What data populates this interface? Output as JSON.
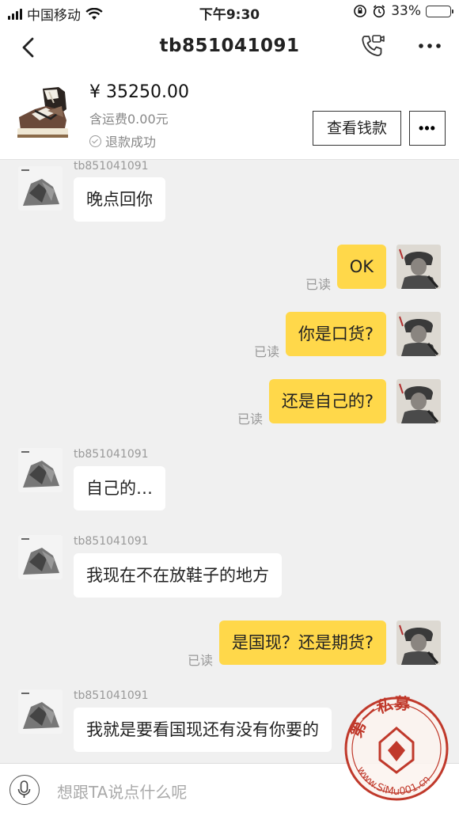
{
  "status_bar": {
    "carrier": "中国移动",
    "time": "下午9:30",
    "battery_percent": "33%",
    "battery_level": 0.33
  },
  "nav": {
    "title": "tb851041091",
    "icons": [
      "chevron-left-icon",
      "video-call-icon",
      "more-dots-icon"
    ]
  },
  "order": {
    "price": "¥ 35250.00",
    "shipping": "含运费0.00元",
    "status": "退款成功",
    "view_money_label": "查看钱款",
    "more_label": "•••"
  },
  "messages": [
    {
      "side": "in",
      "name": "tb851041091",
      "text": "晚点回你"
    },
    {
      "side": "out",
      "read": "已读",
      "text": "OK"
    },
    {
      "side": "out",
      "read": "已读",
      "text": "你是口货?"
    },
    {
      "side": "out",
      "read": "已读",
      "text": "还是自己的?"
    },
    {
      "side": "in",
      "name": "tb851041091",
      "text": "自己的…"
    },
    {
      "side": "in",
      "name": "tb851041091",
      "text": "我现在不在放鞋子的地方"
    },
    {
      "side": "out",
      "read": "已读",
      "text": "是国现？还是期货?"
    },
    {
      "side": "in",
      "name": "tb851041091",
      "text": "我就是要看国现还有没有你要的"
    }
  ],
  "input": {
    "placeholder": "想跟TA说点什么呢"
  },
  "watermark": {
    "top_text": "第一私募",
    "bottom_text": "www.SiMu001.cn"
  },
  "colors": {
    "outgoing_bubble": "#ffd84a",
    "incoming_bubble": "#ffffff",
    "background": "#f0f0f0",
    "watermark": "#c0392b"
  }
}
